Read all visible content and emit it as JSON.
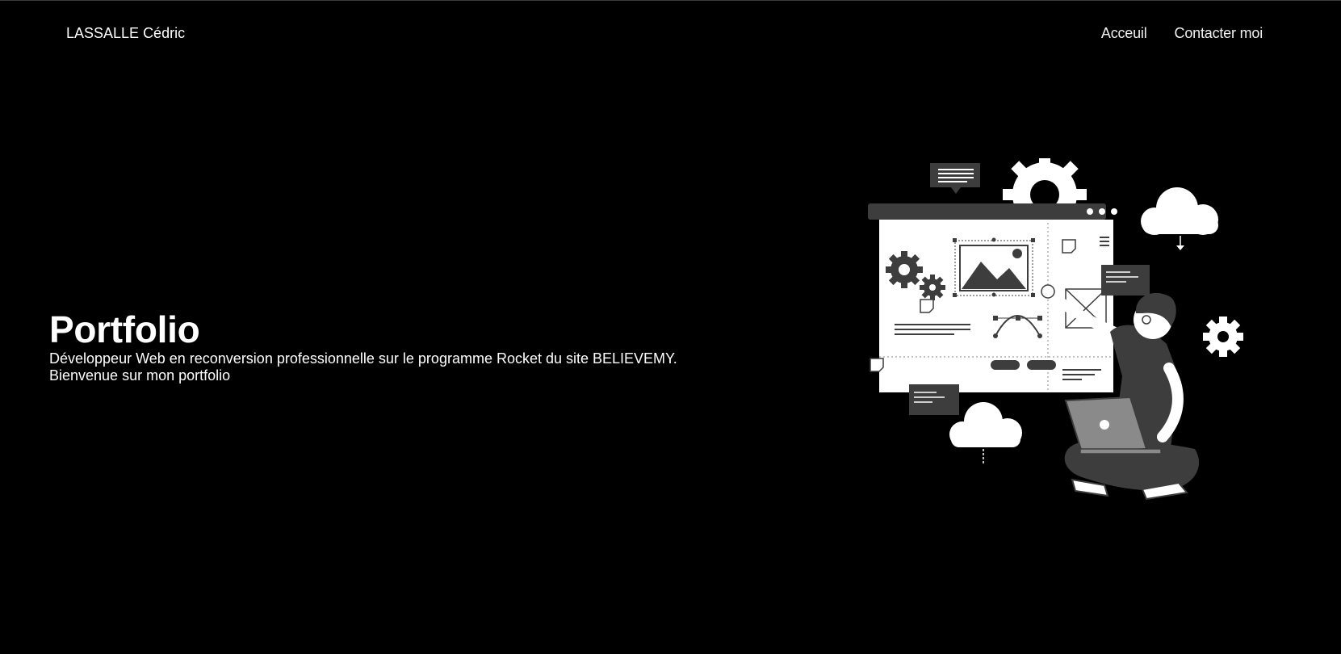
{
  "navbar": {
    "brand": "LASSALLE Cédric",
    "links": [
      {
        "label": "Acceuil"
      },
      {
        "label": "Contacter moi"
      }
    ]
  },
  "hero": {
    "title": "Portfolio",
    "description": "Développeur Web en reconversion professionnelle sur le programme Rocket du site BELIEVEMY.",
    "welcome": "Bienvenue sur mon portfolio"
  },
  "illustration": {
    "icon": "web-developer-illustration",
    "palette": {
      "background": "#000000",
      "light": "#ffffff",
      "dark": "#3d3d3d",
      "mid": "#8a8a8a"
    }
  }
}
